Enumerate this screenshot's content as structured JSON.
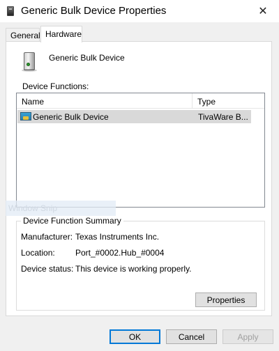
{
  "window": {
    "title": "Generic Bulk Device Properties",
    "close_glyph": "✕",
    "title_icon": "device-icon"
  },
  "tabs": [
    {
      "label": "General",
      "selected": false
    },
    {
      "label": "Hardware",
      "selected": true
    }
  ],
  "device": {
    "name": "Generic Bulk Device",
    "icon": "usb-drive-icon"
  },
  "functions": {
    "label": "Device Functions:",
    "columns": [
      "Name",
      "Type"
    ],
    "rows": [
      {
        "name": "Generic Bulk Device",
        "type": "TivaWare B...",
        "icon": "device-function-icon",
        "selected": true
      }
    ]
  },
  "watermark": "Window Snip",
  "summary": {
    "legend": "Device Function Summary",
    "manufacturer_label": "Manufacturer:",
    "manufacturer": "Texas Instruments Inc.",
    "location_label": "Location:",
    "location": "Port_#0002.Hub_#0004",
    "status_label": "Device status:",
    "status": "This device is working properly.",
    "properties_button": "Properties"
  },
  "buttons": {
    "ok": "OK",
    "cancel": "Cancel",
    "apply": "Apply"
  },
  "colors": {
    "accent": "#0078d7",
    "selection": "#d9d9d9"
  }
}
